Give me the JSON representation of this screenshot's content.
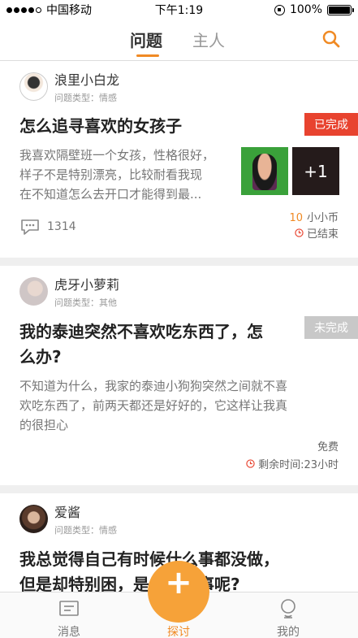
{
  "status_bar": {
    "carrier": "中国移动",
    "time": "下午1:19",
    "battery": "100%"
  },
  "top_nav": {
    "tabs": [
      "问题",
      "主人"
    ]
  },
  "cards": [
    {
      "user": "浪里小白龙",
      "type": "问题类型：情感",
      "title": "怎么追寻喜欢的女孩子",
      "desc_lines": [
        "我喜欢隔壁班一个女孩，性格很好，",
        "样子不是特别漂亮，比较耐看我现",
        "在不知道怎么去开口才能得到最..."
      ],
      "badge": "已完成",
      "extra_count": "+1",
      "comments": "1314",
      "reward_num": "10",
      "reward_unit": "小小币",
      "status": "已结束"
    },
    {
      "user": "虎牙小萝莉",
      "type": "问题类型：其他",
      "title_lines": [
        "我的泰迪突然不喜欢吃东西了，怎",
        "么办?"
      ],
      "desc_lines": [
        "不知道为什么，我家的泰迪小狗狗突然之间就不喜",
        "欢吃东西了，前两天都还是好好的，它这样让我真",
        "的很担心"
      ],
      "badge": "未完成",
      "reward": "免费",
      "remaining": "剩余时间:23小时"
    },
    {
      "user": "爱酱",
      "type": "问题类型：情感",
      "title_lines": [
        "我总觉得自己有时候什么事都没做，",
        "但是却特别困，是怎么回事呢?"
      ]
    }
  ],
  "bottom_tabs": [
    "消息",
    "探讨",
    "我的"
  ],
  "colors": {
    "accent": "#f08a24",
    "done_badge": "#e8432f",
    "pending_badge": "#c8c8c8"
  }
}
